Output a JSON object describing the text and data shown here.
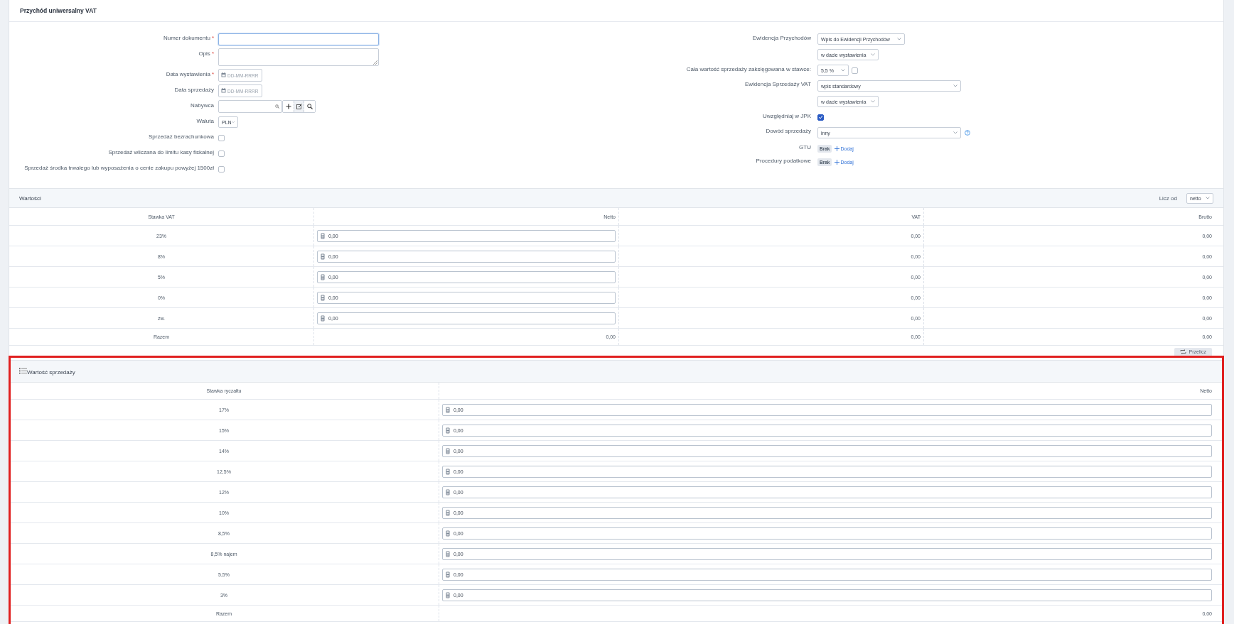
{
  "title": "Przychód uniwersalny VAT",
  "left_fields": [
    {
      "kind": "text",
      "label": "Numer dokumentu",
      "required_mark": "*",
      "focused": true
    },
    {
      "kind": "textarea",
      "label": "Opis",
      "required_mark": "*"
    },
    {
      "kind": "date",
      "label": "Data wystawienia",
      "required_mark": "*",
      "placeholder": "DD-MM-RRRR"
    },
    {
      "kind": "date",
      "label": "Data sprzedaży",
      "placeholder": "DD-MM-RRRR"
    },
    {
      "kind": "search",
      "label": "Nabywca"
    },
    {
      "kind": "select",
      "label": "Waluta",
      "value": "PLN"
    },
    {
      "kind": "checkbox",
      "label": "Sprzedaż bezrachunkowa",
      "checked": false
    },
    {
      "kind": "checkbox",
      "label": "Sprzedaż wliczana do limitu kasy fiskalnej",
      "checked": false
    },
    {
      "kind": "checkbox",
      "label": "Sprzedaż środka trwałego lub wyposażenia o cenie zakupu powyżej 1500zł",
      "checked": false
    }
  ],
  "right_fields": [
    {
      "kind": "midselect",
      "label": "Ewidencja Przychodów",
      "value": "Wpis do Ewidencji Przychodów"
    },
    {
      "kind": "shortselect",
      "value": "w dacie wystawienia"
    },
    {
      "kind": "rateselect",
      "label": "Cała wartość sprzedaży zaksięgowana w stawce:",
      "value": "5,5 %",
      "checked": false
    },
    {
      "kind": "longselect",
      "label": "Ewidencja Sprzedaży VAT",
      "value": "wpis standardowy"
    },
    {
      "kind": "shortselect",
      "value": "w dacie wystawienia"
    },
    {
      "kind": "checkbox",
      "label": "Uwzględniaj w JPK",
      "checked": true
    },
    {
      "kind": "longselect",
      "label": "Dowód sprzedaży",
      "value": "inny",
      "help": true
    },
    {
      "kind": "tags",
      "label": "GTU",
      "badge": "Brak",
      "link": "Dodaj"
    },
    {
      "kind": "tags",
      "label": "Procedury podatkowe",
      "badge": "Brak",
      "link": "Dodaj"
    }
  ],
  "values": {
    "title": "Wartości",
    "calc_label": "Licz od",
    "calc_value": "netto",
    "columns": [
      "Stawka VAT",
      "Netto",
      "VAT",
      "Brutto"
    ],
    "rows": [
      {
        "rate": "23%",
        "netto": "0,00",
        "vat": "0,00",
        "brutto": "0,00"
      },
      {
        "rate": "8%",
        "netto": "0,00",
        "vat": "0,00",
        "brutto": "0,00"
      },
      {
        "rate": "5%",
        "netto": "0,00",
        "vat": "0,00",
        "brutto": "0,00"
      },
      {
        "rate": "0%",
        "netto": "0,00",
        "vat": "0,00",
        "brutto": "0,00"
      },
      {
        "rate": "zw.",
        "netto": "0,00",
        "vat": "0,00",
        "brutto": "0,00"
      }
    ],
    "total": {
      "label": "Razem",
      "netto": "0,00",
      "vat": "0,00",
      "brutto": "0,00"
    },
    "button": "Przelicz"
  },
  "sales": {
    "title": "Wartość sprzedaży",
    "highlighted": true,
    "columns": [
      "Stawka ryczałtu",
      "Netto"
    ],
    "rows": [
      {
        "rate": "17%",
        "netto": "0,00"
      },
      {
        "rate": "15%",
        "netto": "0,00"
      },
      {
        "rate": "14%",
        "netto": "0,00"
      },
      {
        "rate": "12,5%",
        "netto": "0,00"
      },
      {
        "rate": "12%",
        "netto": "0,00"
      },
      {
        "rate": "10%",
        "netto": "0,00"
      },
      {
        "rate": "8,5%",
        "netto": "0,00"
      },
      {
        "rate": "8,5% najem",
        "netto": "0,00"
      },
      {
        "rate": "5,5%",
        "netto": "0,00"
      },
      {
        "rate": "3%",
        "netto": "0,00"
      }
    ],
    "total": {
      "label": "Razem",
      "netto": "0,00"
    }
  }
}
